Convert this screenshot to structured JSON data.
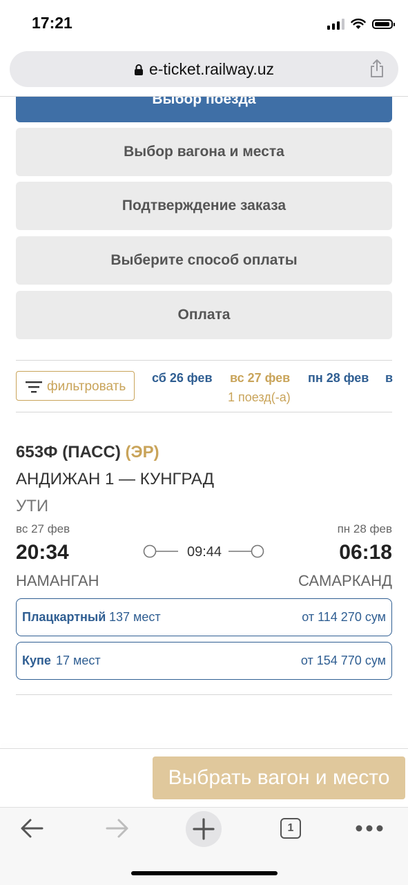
{
  "status_bar": {
    "time": "17:21",
    "signal_bars": 3,
    "battery_level": 0.95
  },
  "browser": {
    "url": "e-ticket.railway.uz",
    "icons": [
      "lock-icon",
      "share-icon"
    ]
  },
  "steps": {
    "active": "Выбор поезда",
    "items": [
      "Выбор вагона и места",
      "Подтверждение заказа",
      "Выберите способ оплаты",
      "Оплата"
    ]
  },
  "filter": {
    "label": "фильтровать",
    "icon": "filter-icon"
  },
  "dates": [
    {
      "label": "сб 26 фев"
    },
    {
      "label": "вс 27 фев",
      "selected": true,
      "sub": "1 поезд(-а)"
    },
    {
      "label": "пн 28 фев"
    },
    {
      "label": "в"
    }
  ],
  "train": {
    "number": "653Ф (ПАСС)",
    "type": "(ЭР)",
    "route": "АНДИЖАН 1 — КУНГРАД",
    "carrier": "УТИ",
    "departure": {
      "date": "вс 27 фев",
      "time": "20:34",
      "station": "НАМАНГАН"
    },
    "arrival": {
      "date": "пн 28 фев",
      "time": "06:18",
      "station": "САМАРКАНД"
    },
    "duration": "09:44"
  },
  "fares": [
    {
      "class": "Плацкартный",
      "seats": "137 мест",
      "price": "от 114 270 сум"
    },
    {
      "class": "Купе",
      "seats": "17 мест",
      "price": "от 154 770 сум"
    }
  ],
  "cta": {
    "label": "Выбрать вагон и место"
  },
  "toolbar": {
    "tabs_count": "1",
    "icons": [
      "back-arrow-icon",
      "forward-arrow-icon",
      "new-tab-plus-icon",
      "tabs-icon",
      "more-dots-icon"
    ]
  },
  "colors": {
    "primary": "#3f6fa6",
    "link": "#2f5e92",
    "accent": "#c9a45a",
    "cta": "#e0c89c",
    "step_bg": "#ebebeb"
  }
}
